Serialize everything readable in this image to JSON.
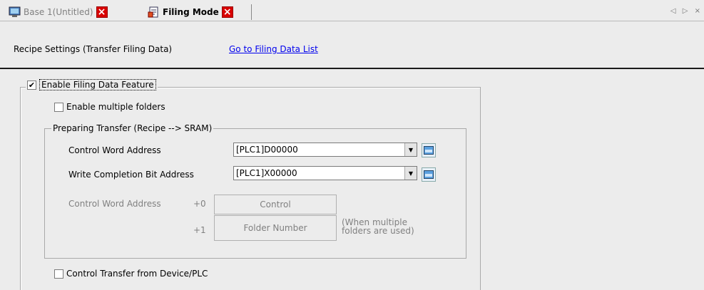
{
  "tabs": [
    {
      "label": "Base 1(Untitled)",
      "icon": "screen-icon",
      "active": false
    },
    {
      "label": "Filing Mode",
      "icon": "document-icon",
      "active": true
    }
  ],
  "tab_nav": "◁ ▷ ×",
  "header": {
    "title": "Recipe Settings (Transfer Filing Data)",
    "link": "Go to Filing Data List"
  },
  "enable_filing": {
    "label": "Enable Filing Data Feature",
    "checked": true
  },
  "multiple_folders": {
    "label": "Enable multiple folders",
    "checked": false
  },
  "preparing_transfer": {
    "title": "Preparing Transfer (Recipe --> SRAM)",
    "control_word": {
      "label": "Control Word Address",
      "value": "[PLC1]D00000"
    },
    "write_completion": {
      "label": "Write Completion Bit Address",
      "value": "[PLC1]X00000"
    },
    "offset_table": {
      "label": "Control Word Address",
      "rows": [
        {
          "offset": "+0",
          "value": "Control"
        },
        {
          "offset": "+1",
          "value": "Folder Number"
        }
      ],
      "note_line1": "(When multiple",
      "note_line2": "folders are used)"
    }
  },
  "control_transfer": {
    "label": "Control Transfer from Device/PLC",
    "checked": false
  },
  "colors": {
    "close": "#d80000",
    "link": "#0000ee",
    "panel": "#ececec"
  }
}
